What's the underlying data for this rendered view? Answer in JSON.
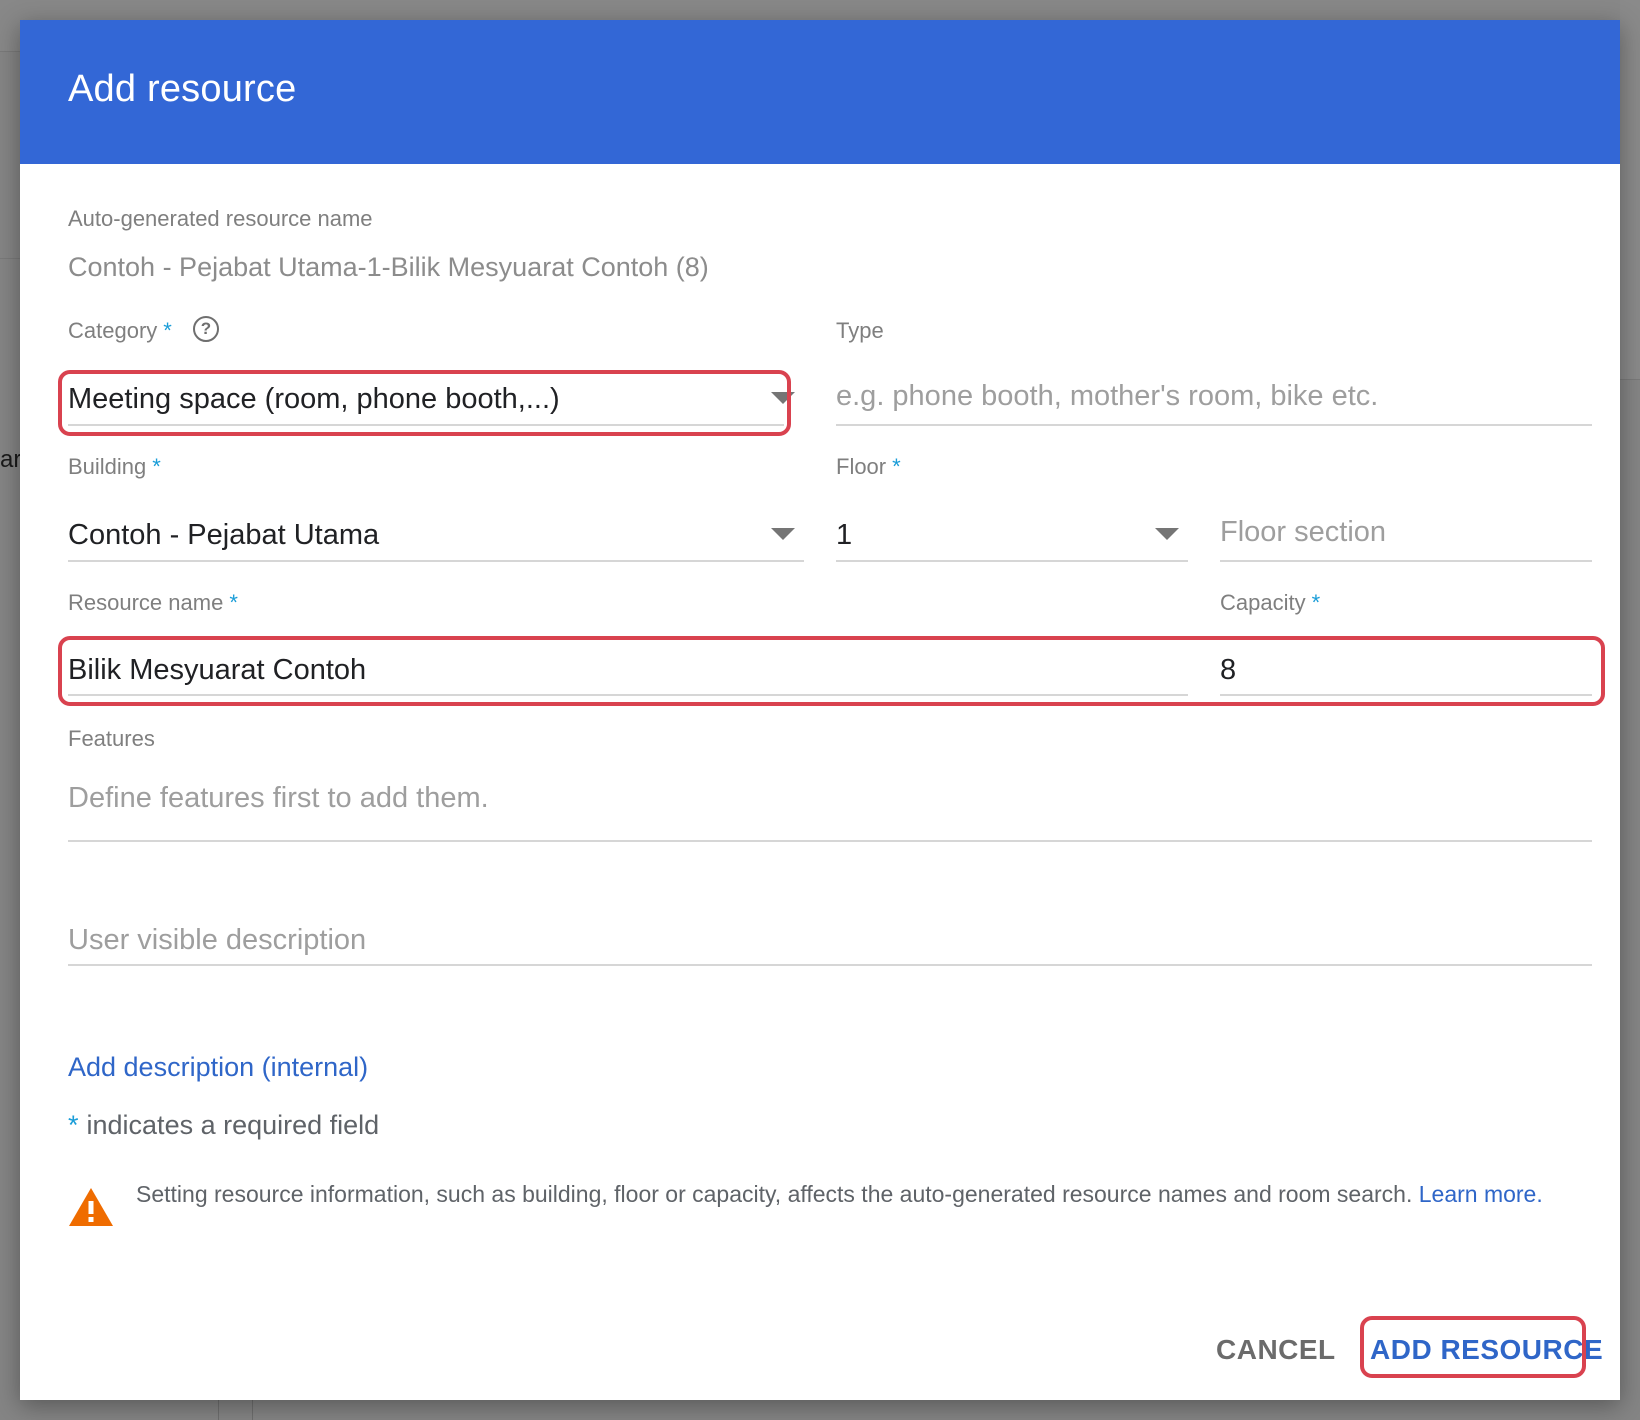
{
  "background": {
    "edge_text": "ar"
  },
  "dialog": {
    "title": "Add resource",
    "autogen": {
      "label": "Auto-generated resource name",
      "value": "Contoh - Pejabat Utama-1-Bilik Mesyuarat Contoh (8)"
    },
    "category": {
      "label": "Category",
      "required_marker": "*",
      "help_icon": "question-circle-icon",
      "value": "Meeting space (room, phone booth,...)"
    },
    "type": {
      "label": "Type",
      "placeholder": "e.g. phone booth, mother's room, bike etc."
    },
    "building": {
      "label": "Building",
      "required_marker": "*",
      "value": "Contoh - Pejabat Utama"
    },
    "floor": {
      "label": "Floor",
      "required_marker": "*",
      "value": "1"
    },
    "floor_section": {
      "placeholder": "Floor section"
    },
    "resource_name": {
      "label": "Resource name",
      "required_marker": "*",
      "value": "Bilik Mesyuarat Contoh"
    },
    "capacity": {
      "label": "Capacity",
      "required_marker": "*",
      "value": "8"
    },
    "features": {
      "label": "Features",
      "empty_text": "Define features first to add them."
    },
    "user_description": {
      "placeholder": "User visible description"
    },
    "add_internal_link": "Add description (internal)",
    "required_note": {
      "marker": "*",
      "text": "indicates a required field"
    },
    "warning": {
      "icon": "warning-triangle-icon",
      "text": "Setting resource information, such as building, floor or capacity, affects the auto-generated resource names and room search.",
      "link_text": "Learn more."
    },
    "actions": {
      "cancel_label": "CANCEL",
      "add_label": "ADD RESOURCE"
    }
  },
  "colors": {
    "header": "#3367d6",
    "accent_link": "#2f66c8",
    "required_star": "#1a9dd8",
    "highlight": "#d9424f",
    "warning": "#ef6c00"
  }
}
